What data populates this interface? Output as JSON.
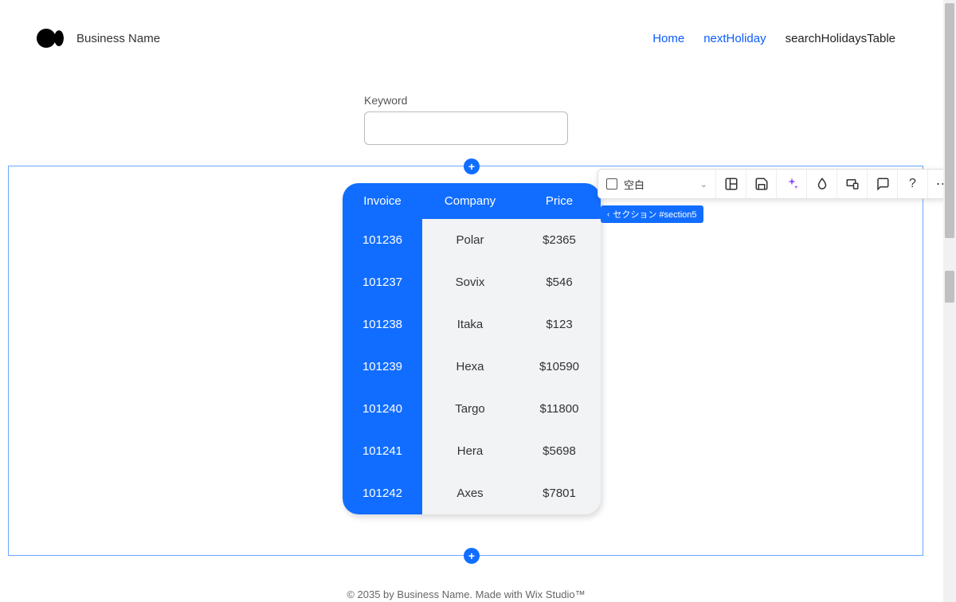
{
  "header": {
    "brand_name": "Business Name",
    "nav": [
      {
        "label": "Home",
        "style": "blue"
      },
      {
        "label": "nextHoliday",
        "style": "blue"
      },
      {
        "label": "searchHolidaysTable",
        "style": "dark"
      }
    ]
  },
  "keyword": {
    "label": "Keyword",
    "value": ""
  },
  "table": {
    "headers": [
      "Invoice",
      "Company",
      "Price"
    ],
    "rows": [
      {
        "invoice": "101236",
        "company": "Polar",
        "price": "$2365"
      },
      {
        "invoice": "101237",
        "company": "Sovix",
        "price": "$546"
      },
      {
        "invoice": "101238",
        "company": "Itaka",
        "price": "$123"
      },
      {
        "invoice": "101239",
        "company": "Hexa",
        "price": "$10590"
      },
      {
        "invoice": "101240",
        "company": "Targo",
        "price": "$11800"
      },
      {
        "invoice": "101241",
        "company": "Hera",
        "price": "$5698"
      },
      {
        "invoice": "101242",
        "company": "Axes",
        "price": "$7801"
      }
    ]
  },
  "toolbar": {
    "select_label": "空白",
    "icons": {
      "layout": "layout-icon",
      "save": "save-icon",
      "ai": "sparkle-icon",
      "drop": "drop-icon",
      "responsive": "responsive-icon",
      "comment": "comment-icon",
      "help": "?",
      "more": "⋯"
    }
  },
  "section_tag": {
    "prefix": "‹",
    "label": "セクション #section5"
  },
  "add_button_glyph": "+",
  "footer": {
    "text": "© 2035 by Business Name. Made with Wix Studio™"
  }
}
